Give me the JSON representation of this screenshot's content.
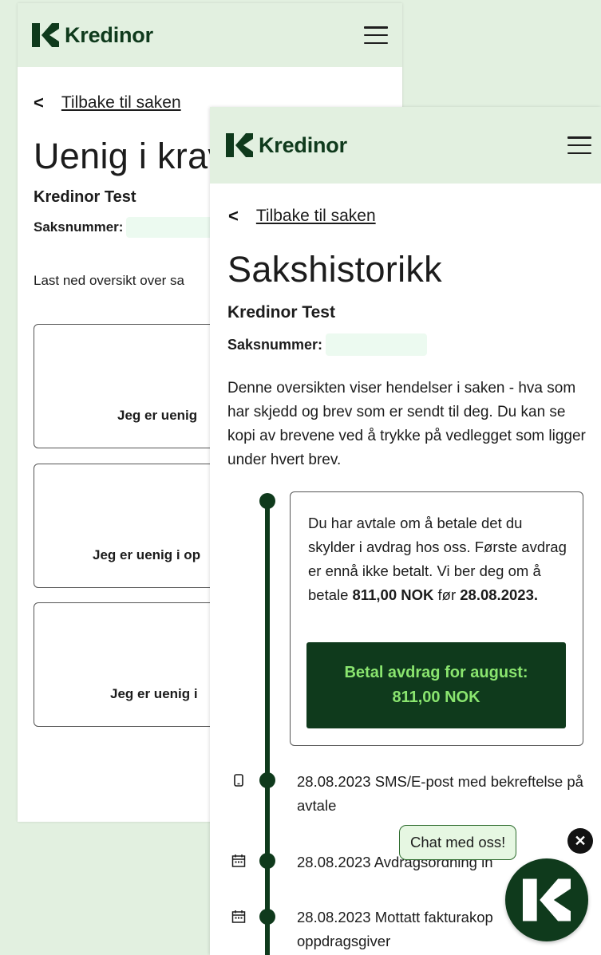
{
  "brand": {
    "name": "Kredinor",
    "color": "#0f3a1c",
    "accent": "#8ae56f",
    "header_bg": "#e2f0e0"
  },
  "back_screen": {
    "back_link": "Tilbake til saken",
    "title": "Uenig i krav",
    "owner": "Kredinor Test",
    "case_label": "Saksnummer:",
    "download_text": "Last ned oversikt over sa",
    "options": [
      {
        "label": "Jeg er uenig",
        "icon": "clock-icon"
      },
      {
        "label": "Jeg er uenig i op",
        "icon": "document-icon"
      },
      {
        "label": "Jeg er uenig i",
        "icon": "info-icon"
      }
    ]
  },
  "front_screen": {
    "back_link": "Tilbake til saken",
    "title": "Sakshistorikk",
    "owner": "Kredinor Test",
    "case_label": "Saksnummer:",
    "intro": "Denne oversikten viser hendelser i saken - hva som har skjedd og brev som er sendt til deg. Du kan se kopi av brevene ved å trykke på vedlegget som ligger under hvert brev.",
    "notice": {
      "text_before": "Du har avtale om å betale det du skylder i avdrag hos oss. Første avdrag er ennå ikke betalt. Vi ber deg om å betale ",
      "amount": "811,00 NOK",
      "text_mid": " før ",
      "date": "28.08.2023.",
      "button_line1": "Betal avdrag for august:",
      "button_line2": "811,00 NOK"
    },
    "events": [
      {
        "text": "28.08.2023 SMS/E-post med bekreftelse på avtale",
        "icon": "phone-icon"
      },
      {
        "text": "28.08.2023 Avdragsordning in",
        "icon": "calendar-icon"
      },
      {
        "text": "28.08.2023 Mottatt fakturakop oppdragsgiver",
        "icon": "calendar-icon"
      }
    ]
  },
  "chat": {
    "tooltip": "Chat med oss!",
    "close_icon": "close-icon",
    "launcher_icon": "kredinor-logo-icon"
  }
}
